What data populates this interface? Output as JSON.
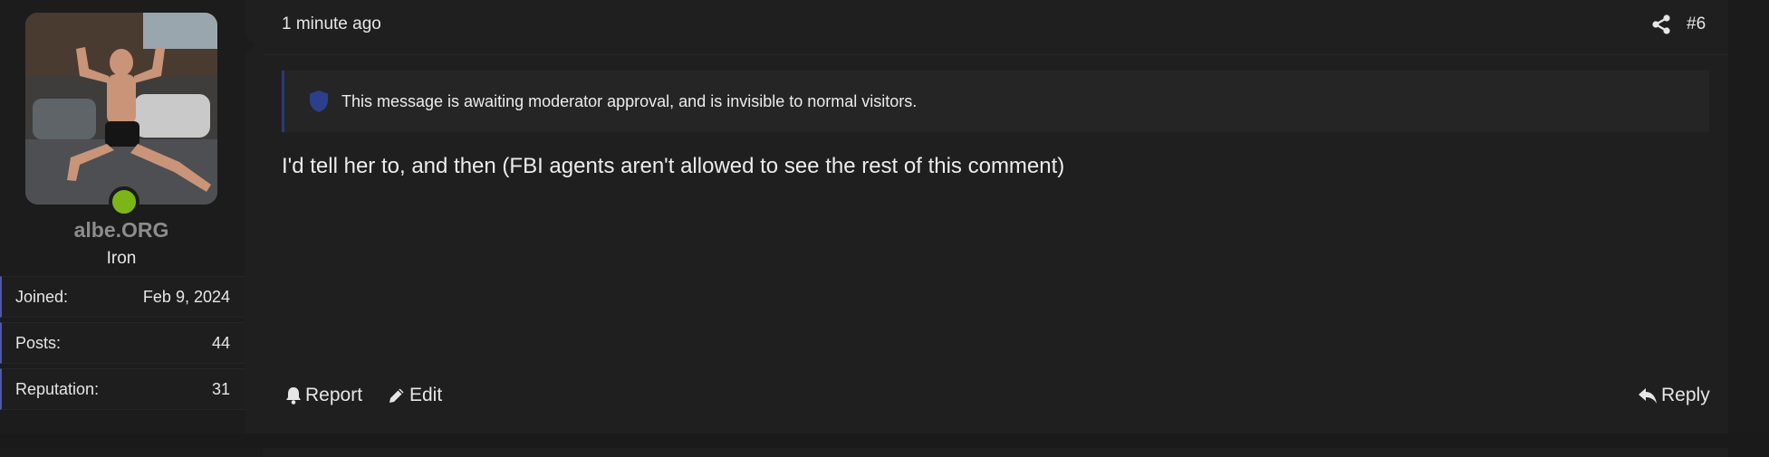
{
  "user": {
    "username": "albe.ORG",
    "title": "Iron",
    "online": true,
    "stats": [
      {
        "key": "Joined:",
        "value": "Feb 9, 2024"
      },
      {
        "key": "Posts:",
        "value": "44"
      },
      {
        "key": "Reputation:",
        "value": "31"
      }
    ]
  },
  "post": {
    "time": "1 minute ago",
    "number": "#6",
    "notice": "This message is awaiting moderator approval, and is invisible to normal visitors.",
    "body": "I'd tell her to, and then (FBI agents aren't allowed to see the rest of this comment)"
  },
  "actions": {
    "report": "Report",
    "edit": "Edit",
    "reply": "Reply"
  },
  "icons": {
    "share": "share-icon",
    "shield": "shield-icon",
    "bell": "bell-icon",
    "pencil": "pencil-icon",
    "reply": "reply-icon"
  },
  "colors": {
    "online": "#7cb518",
    "notice_border": "#2d3a78",
    "shield": "#2b3f8a",
    "stat_border": "#4d5aa8"
  }
}
